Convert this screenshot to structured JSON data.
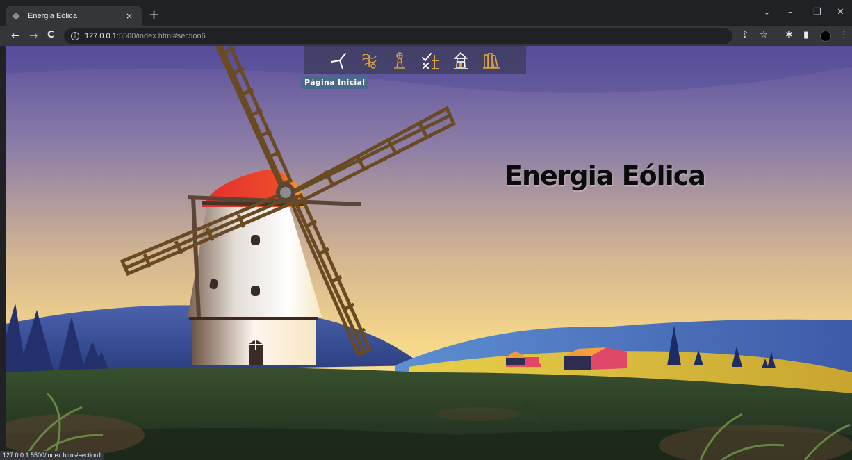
{
  "browser": {
    "tab_title": "Energia Eólica",
    "tab_close": "×",
    "new_tab": "+",
    "url_host": "127.0.0.1",
    "url_path": ":5500/index.html#section6",
    "status_url": "127.0.0.1:5500/index.html#section1",
    "window_controls": {
      "dropdown": "⌄",
      "minimize": "–",
      "restore": "❐",
      "close": "✕"
    },
    "nav": {
      "back": "←",
      "forward": "→",
      "reload": "C"
    },
    "toolbar_icons": {
      "share": "⇪",
      "star": "☆",
      "extensions": "✱",
      "sidepanel": "▮",
      "menu": "⋮"
    }
  },
  "page": {
    "hero_title": "Energia Eólica",
    "nav_tooltip": "Página Inicial",
    "nav_items": [
      {
        "icon": "wind-turbine-icon"
      },
      {
        "icon": "wind-gust-icon"
      },
      {
        "icon": "windmill-tower-icon"
      },
      {
        "icon": "pros-cons-icon"
      },
      {
        "icon": "lighthouse-icon"
      },
      {
        "icon": "book-icon"
      }
    ],
    "colors": {
      "sky_top": "#5a4f9e",
      "sky_bottom": "#f6d88a",
      "navbar_icon_gold": "#e0a53a",
      "tooltip_bg": "#4b6a8a"
    }
  }
}
